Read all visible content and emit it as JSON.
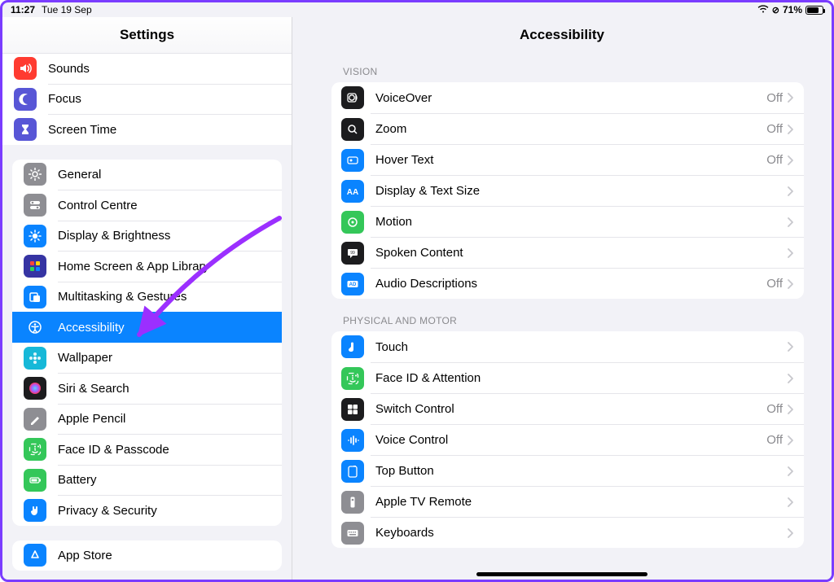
{
  "status": {
    "time": "11:27",
    "date": "Tue 19 Sep",
    "battery_pct": "71%",
    "wifi_icon": "wifi",
    "orientation_lock_icon": "lock"
  },
  "sidebar": {
    "title": "Settings",
    "group1": [
      {
        "label": "Sounds",
        "icon": "speaker",
        "bg": "#ff3b30"
      },
      {
        "label": "Focus",
        "icon": "moon",
        "bg": "#5856d6"
      },
      {
        "label": "Screen Time",
        "icon": "hourglass",
        "bg": "#5856d6"
      }
    ],
    "group2": [
      {
        "label": "General",
        "icon": "gear",
        "bg": "#8e8e93"
      },
      {
        "label": "Control Centre",
        "icon": "switches",
        "bg": "#8e8e93"
      },
      {
        "label": "Display & Brightness",
        "icon": "sun",
        "bg": "#0a84ff"
      },
      {
        "label": "Home Screen & App Library",
        "icon": "grid",
        "bg": "#3634a3"
      },
      {
        "label": "Multitasking & Gestures",
        "icon": "rect-overlap",
        "bg": "#0a84ff"
      },
      {
        "label": "Accessibility",
        "icon": "access",
        "bg": "#0a84ff",
        "selected": true
      },
      {
        "label": "Wallpaper",
        "icon": "flower",
        "bg": "#16b8d8"
      },
      {
        "label": "Siri & Search",
        "icon": "siri",
        "bg": "#1c1c1e"
      },
      {
        "label": "Apple Pencil",
        "icon": "pencil",
        "bg": "#8e8e93"
      },
      {
        "label": "Face ID & Passcode",
        "icon": "faceid",
        "bg": "#34c759"
      },
      {
        "label": "Battery",
        "icon": "battery",
        "bg": "#34c759"
      },
      {
        "label": "Privacy & Security",
        "icon": "hand",
        "bg": "#0a84ff"
      }
    ],
    "group3": [
      {
        "label": "App Store",
        "icon": "appstore",
        "bg": "#0a84ff"
      }
    ]
  },
  "detail": {
    "title": "Accessibility",
    "sections": [
      {
        "header": "VISION",
        "rows": [
          {
            "label": "VoiceOver",
            "icon": "voiceover",
            "bg": "#1c1c1e",
            "value": "Off"
          },
          {
            "label": "Zoom",
            "icon": "zoom",
            "bg": "#1c1c1e",
            "value": "Off"
          },
          {
            "label": "Hover Text",
            "icon": "hover",
            "bg": "#0a84ff",
            "value": "Off"
          },
          {
            "label": "Display & Text Size",
            "icon": "aa",
            "bg": "#0a84ff",
            "value": ""
          },
          {
            "label": "Motion",
            "icon": "motion",
            "bg": "#34c759",
            "value": ""
          },
          {
            "label": "Spoken Content",
            "icon": "bubble",
            "bg": "#1c1c1e",
            "value": ""
          },
          {
            "label": "Audio Descriptions",
            "icon": "ad",
            "bg": "#0a84ff",
            "value": "Off"
          }
        ]
      },
      {
        "header": "PHYSICAL AND MOTOR",
        "rows": [
          {
            "label": "Touch",
            "icon": "touch",
            "bg": "#0a84ff",
            "value": ""
          },
          {
            "label": "Face ID & Attention",
            "icon": "faceid",
            "bg": "#34c759",
            "value": ""
          },
          {
            "label": "Switch Control",
            "icon": "switchc",
            "bg": "#1c1c1e",
            "value": "Off"
          },
          {
            "label": "Voice Control",
            "icon": "voicec",
            "bg": "#0a84ff",
            "value": "Off"
          },
          {
            "label": "Top Button",
            "icon": "topbtn",
            "bg": "#0a84ff",
            "value": ""
          },
          {
            "label": "Apple TV Remote",
            "icon": "remote",
            "bg": "#8e8e93",
            "value": ""
          },
          {
            "label": "Keyboards",
            "icon": "keyboard",
            "bg": "#8e8e93",
            "value": ""
          }
        ]
      }
    ]
  },
  "annotation": {
    "arrow_color": "#9b2fff"
  }
}
